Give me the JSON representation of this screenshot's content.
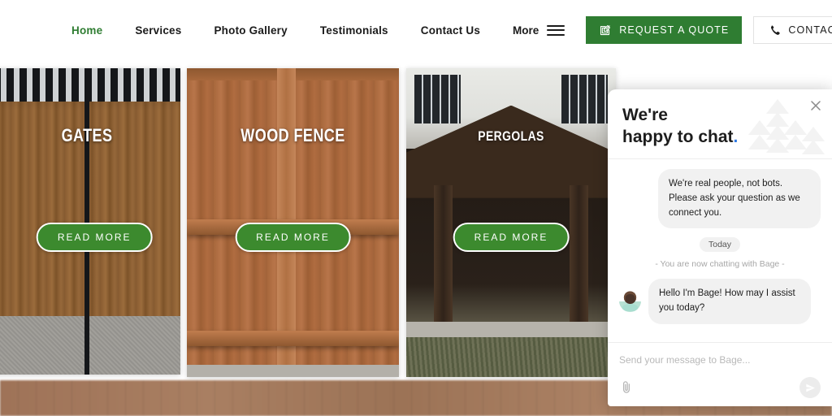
{
  "nav": {
    "links": [
      {
        "label": "Home",
        "active": true
      },
      {
        "label": "Services",
        "active": false
      },
      {
        "label": "Photo Gallery",
        "active": false
      },
      {
        "label": "Testimonials",
        "active": false
      },
      {
        "label": "Contact Us",
        "active": false
      }
    ],
    "more_label": "More",
    "menu_icon": "hamburger-icon",
    "quote_button": {
      "label": "REQUEST A QUOTE",
      "icon": "edit-square-icon",
      "color": "#2f7d32"
    },
    "contact_button": {
      "label": "CONTACT",
      "icon": "phone-icon"
    }
  },
  "cards": [
    {
      "title": "GATES",
      "cta": "READ MORE",
      "image": "wood-gate-photo"
    },
    {
      "title": "WOOD FENCE",
      "cta": "READ MORE",
      "image": "wood-fence-photo"
    },
    {
      "title": "PERGOLAS",
      "cta": "READ MORE",
      "image": "pergola-photo"
    }
  ],
  "chat": {
    "title_line1": "We're",
    "title_line2": "happy to chat",
    "title_dot": ".",
    "dot_color": "#2f7ae5",
    "close_icon": "close-icon",
    "decor_icon": "tree-pattern-icon",
    "intro_message": "We're real people, not bots. Please ask your question as we connect you.",
    "day_badge": "Today",
    "system_line": "- You are now chatting with Bage -",
    "agent_name": "Bage",
    "agent_avatar": "agent-avatar",
    "agent_message": "Hello I'm Bage! How may I assist you today?",
    "input_placeholder": "Send your message to Bage...",
    "input_value": "",
    "attach_icon": "paperclip-icon",
    "send_icon": "send-icon"
  },
  "theme": {
    "brand_green": "#2f7d32",
    "button_green": "#3c8a2e",
    "text_dark": "#1b1b1b"
  }
}
